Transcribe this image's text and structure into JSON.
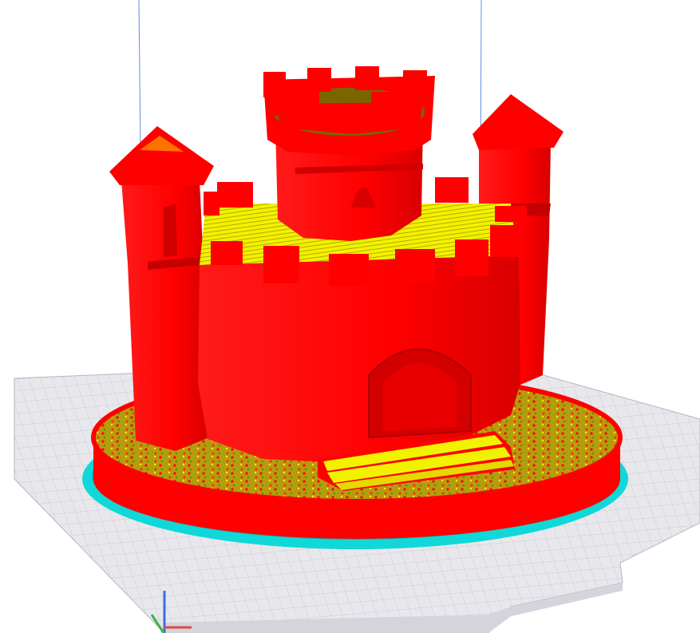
{
  "viewport": {
    "background": "#ffffff",
    "colors": {
      "model_wall": "#ff0000",
      "model_wall_dark": "#d40000",
      "infill_top": "#f2f200",
      "infill_dark": "#9a8c00",
      "ground_texture": "#7fb800",
      "skirt": "#10d8d8",
      "skirt_dark": "#0aaeb0",
      "build_plate": "#e8e8ec",
      "build_plate_grid": "#c9c9d2",
      "build_volume_line": "#5a8ee6",
      "axis_x": "#e04a4a",
      "axis_y": "#3cb44b",
      "axis_z": "#3a6fdc"
    },
    "icons": [
      "x-axis-icon",
      "y-axis-icon",
      "z-axis-icon"
    ]
  }
}
